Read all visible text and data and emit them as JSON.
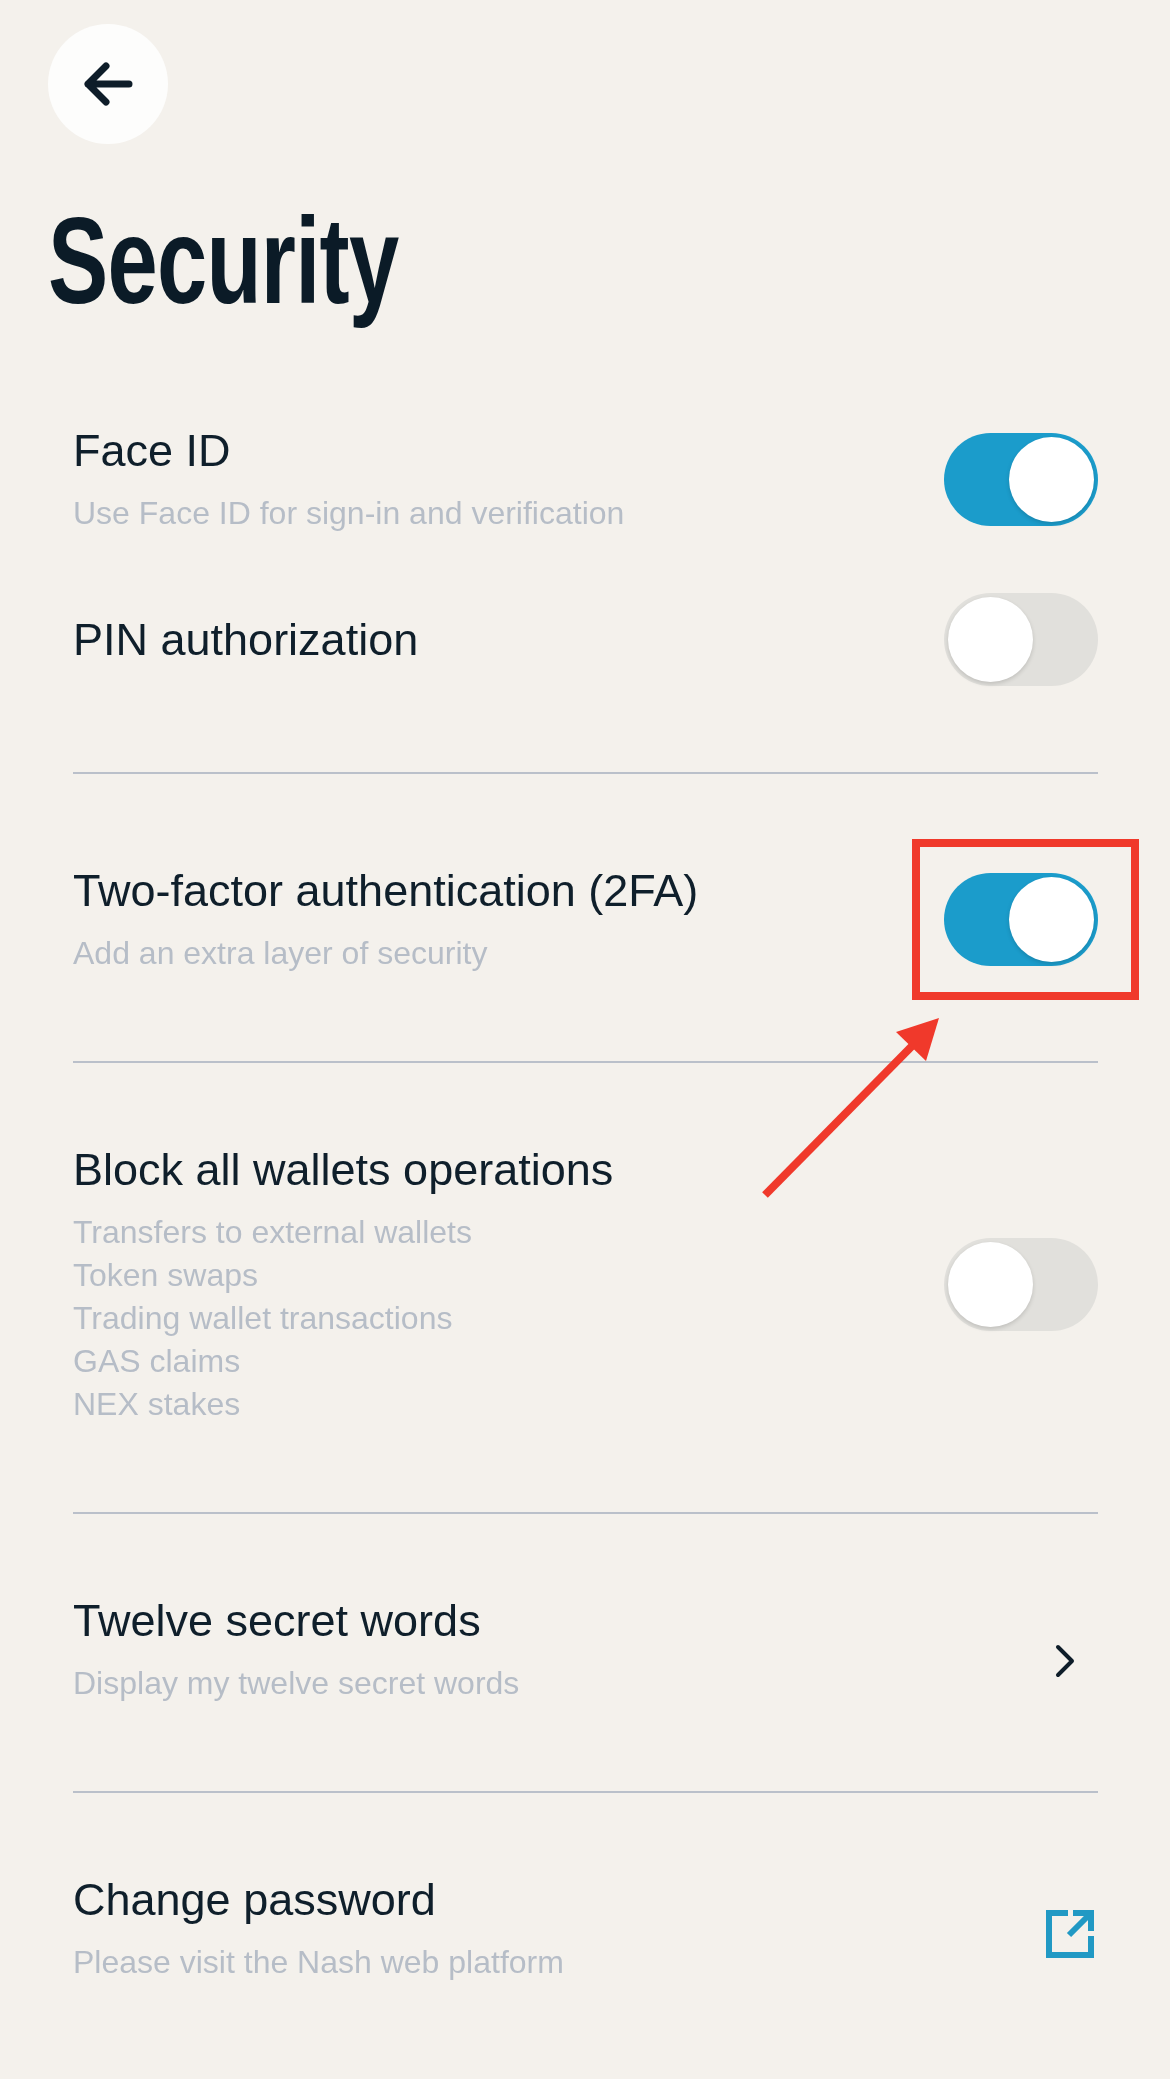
{
  "title": "Security",
  "sections": [
    {
      "items": [
        {
          "kind": "toggle",
          "title": "Face ID",
          "subtitle": "Use Face ID for sign-in and verification",
          "on": true
        },
        {
          "kind": "toggle",
          "title": "PIN authorization",
          "on": false
        }
      ]
    },
    {
      "items": [
        {
          "kind": "toggle",
          "title": "Two-factor authentication (2FA)",
          "subtitle": "Add an extra layer of security",
          "on": true,
          "highlighted": true
        }
      ]
    },
    {
      "items": [
        {
          "kind": "toggle",
          "title": "Block all wallets operations",
          "details": [
            "Transfers to external wallets",
            "Token swaps",
            "Trading wallet transactions",
            "GAS claims",
            "NEX stakes"
          ],
          "on": false
        }
      ]
    },
    {
      "items": [
        {
          "kind": "link",
          "title": "Twelve secret words",
          "subtitle": "Display my twelve secret words"
        }
      ]
    },
    {
      "items": [
        {
          "kind": "external",
          "title": "Change password",
          "subtitle": "Please visit the Nash web platform"
        }
      ]
    }
  ]
}
